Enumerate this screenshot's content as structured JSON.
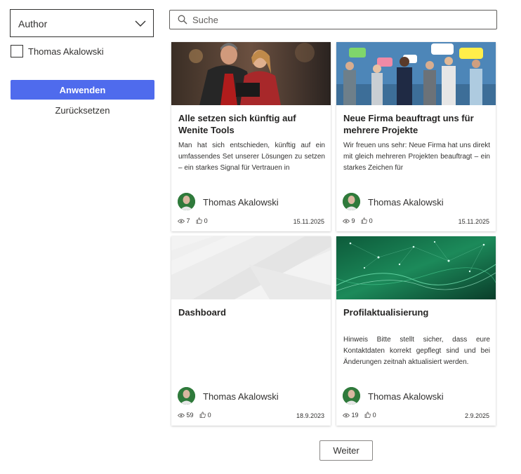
{
  "filter": {
    "author_dropdown": {
      "selected": "Author"
    },
    "author_option": {
      "label": "Thomas Akalowski",
      "checked": false
    },
    "apply_label": "Anwenden",
    "reset_label": "Zurücksetzen"
  },
  "search": {
    "placeholder": "Suche",
    "value": ""
  },
  "cards": [
    {
      "title": "Alle setzen sich künftig auf Wenite Tools",
      "excerpt": "Man hat sich entschieden, künftig auf ein umfassendes Set unserer Lösungen zu setzen – ein starkes Signal für Vertrauen in",
      "author": "Thomas Akalowski",
      "views": "7",
      "likes": "0",
      "date": "15.11.2025",
      "image": "photo-two-people-laptop"
    },
    {
      "title": "Neue Firma beauftragt uns für mehrere Projekte",
      "excerpt": "Wir freuen uns sehr: Neue Firma hat uns direkt mit gleich mehreren Projekten beauftragt – ein starkes Zeichen für",
      "author": "Thomas Akalowski",
      "views": "9",
      "likes": "0",
      "date": "15.11.2025",
      "image": "photo-people-speech-bubbles"
    },
    {
      "title": "Dashboard",
      "excerpt": "",
      "author": "Thomas Akalowski",
      "views": "59",
      "likes": "0",
      "date": "18.9.2023",
      "image": "abstract-grey-shapes"
    },
    {
      "title": "Profilaktualisierung",
      "excerpt": "Hinweis Bitte stellt sicher, dass eure Kontaktdaten korrekt gepflegt sind und bei Änderungen zeitnah aktualisiert werden.",
      "author": "Thomas Akalowski",
      "views": "19",
      "likes": "0",
      "date": "2.9.2025",
      "image": "green-network-abstract"
    }
  ],
  "pager": {
    "next_label": "Weiter"
  },
  "colors": {
    "accent": "#4f6bed",
    "text": "#323130",
    "border": "#8a8886"
  },
  "icons": [
    "chevron-down-icon",
    "search-icon",
    "views-icon",
    "like-icon"
  ]
}
